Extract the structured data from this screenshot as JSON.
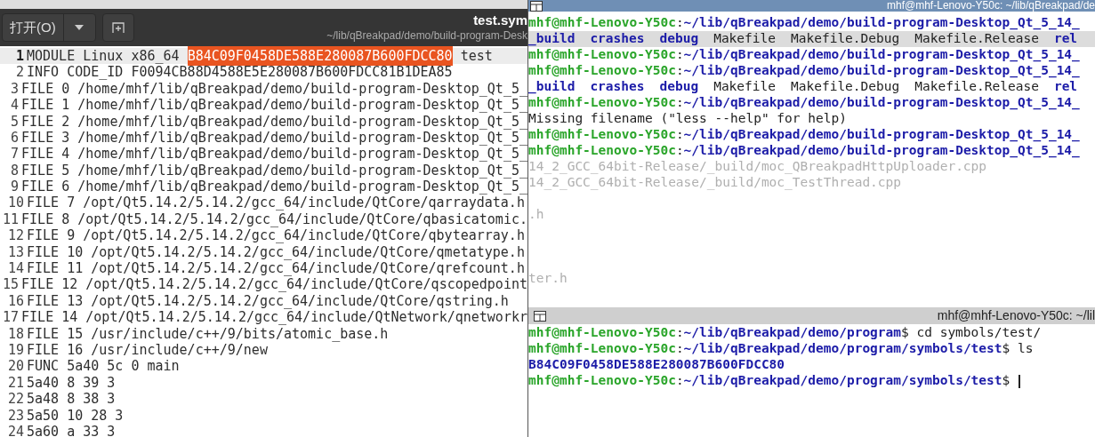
{
  "editor": {
    "open_button": "打开(O)",
    "title": "test.sym",
    "subtitle": "~/lib/qBreakpad/demo/build-program-Desk",
    "lines": [
      {
        "number": "1",
        "current": true,
        "segments": [
          {
            "text": "MODULE Linux x86_64 ",
            "selected": false
          },
          {
            "text": "B84C09F0458DE588E280087B600FDCC80",
            "selected": true
          },
          {
            "text": " test",
            "selected": false
          }
        ]
      },
      {
        "number": "2",
        "current": false,
        "text": "INFO CODE_ID F0094CB88D4588E5E280087B600FDCC81B1DEA85"
      },
      {
        "number": "3",
        "current": false,
        "text": "FILE 0 /home/mhf/lib/qBreakpad/demo/build-program-Desktop_Qt_5_"
      },
      {
        "number": "4",
        "current": false,
        "text": "FILE 1 /home/mhf/lib/qBreakpad/demo/build-program-Desktop_Qt_5_"
      },
      {
        "number": "5",
        "current": false,
        "text": "FILE 2 /home/mhf/lib/qBreakpad/demo/build-program-Desktop_Qt_5_"
      },
      {
        "number": "6",
        "current": false,
        "text": "FILE 3 /home/mhf/lib/qBreakpad/demo/build-program-Desktop_Qt_5_"
      },
      {
        "number": "7",
        "current": false,
        "text": "FILE 4 /home/mhf/lib/qBreakpad/demo/build-program-Desktop_Qt_5_"
      },
      {
        "number": "8",
        "current": false,
        "text": "FILE 5 /home/mhf/lib/qBreakpad/demo/build-program-Desktop_Qt_5_"
      },
      {
        "number": "9",
        "current": false,
        "text": "FILE 6 /home/mhf/lib/qBreakpad/demo/build-program-Desktop_Qt_5_"
      },
      {
        "number": "10",
        "current": false,
        "text": "FILE 7 /opt/Qt5.14.2/5.14.2/gcc_64/include/QtCore/qarraydata.h"
      },
      {
        "number": "11",
        "current": false,
        "text": "FILE 8 /opt/Qt5.14.2/5.14.2/gcc_64/include/QtCore/qbasicatomic."
      },
      {
        "number": "12",
        "current": false,
        "text": "FILE 9 /opt/Qt5.14.2/5.14.2/gcc_64/include/QtCore/qbytearray.h"
      },
      {
        "number": "13",
        "current": false,
        "text": "FILE 10 /opt/Qt5.14.2/5.14.2/gcc_64/include/QtCore/qmetatype.h"
      },
      {
        "number": "14",
        "current": false,
        "text": "FILE 11 /opt/Qt5.14.2/5.14.2/gcc_64/include/QtCore/qrefcount.h"
      },
      {
        "number": "15",
        "current": false,
        "text": "FILE 12 /opt/Qt5.14.2/5.14.2/gcc_64/include/QtCore/qscopedpoint"
      },
      {
        "number": "16",
        "current": false,
        "text": "FILE 13 /opt/Qt5.14.2/5.14.2/gcc_64/include/QtCore/qstring.h"
      },
      {
        "number": "17",
        "current": false,
        "text": "FILE 14 /opt/Qt5.14.2/5.14.2/gcc_64/include/QtNetwork/qnetworkr"
      },
      {
        "number": "18",
        "current": false,
        "text": "FILE 15 /usr/include/c++/9/bits/atomic_base.h"
      },
      {
        "number": "19",
        "current": false,
        "text": "FILE 16 /usr/include/c++/9/new"
      },
      {
        "number": "20",
        "current": false,
        "text": "FUNC 5a40 5c 0 main"
      },
      {
        "number": "21",
        "current": false,
        "text": "5a40 8 39 3"
      },
      {
        "number": "22",
        "current": false,
        "text": "5a48 8 38 3"
      },
      {
        "number": "23",
        "current": false,
        "text": "5a50 10 28 3"
      },
      {
        "number": "24",
        "current": false,
        "text": "5a60 a 33 3"
      }
    ]
  },
  "terminals": [
    {
      "title": "mhf@mhf-Lenovo-Y50c: ~/lib/qBreakpad/de",
      "lines": [
        {
          "kind": "prompt",
          "user": "mhf@mhf-Lenovo-Y50c",
          "colon": ":",
          "path": "~/lib/qBreakpad/demo/build-program-Desktop_Qt_5_14_"
        },
        {
          "kind": "listing",
          "highlighted": true,
          "items": [
            {
              "text": "_build",
              "kind": "dir"
            },
            {
              "text": "crashes",
              "kind": "dir"
            },
            {
              "text": "debug",
              "kind": "dir"
            },
            {
              "text": "Makefile",
              "kind": "file"
            },
            {
              "text": "Makefile.Debug",
              "kind": "file"
            },
            {
              "text": "Makefile.Release",
              "kind": "file"
            },
            {
              "text": "rel",
              "kind": "dir"
            }
          ]
        },
        {
          "kind": "prompt",
          "user": "mhf@mhf-Lenovo-Y50c",
          "colon": ":",
          "path": "~/lib/qBreakpad/demo/build-program-Desktop_Qt_5_14_"
        },
        {
          "kind": "prompt",
          "user": "mhf@mhf-Lenovo-Y50c",
          "colon": ":",
          "path": "~/lib/qBreakpad/demo/build-program-Desktop_Qt_5_14_"
        },
        {
          "kind": "listing",
          "highlighted": false,
          "items": [
            {
              "text": "_build",
              "kind": "dir"
            },
            {
              "text": "crashes",
              "kind": "dir"
            },
            {
              "text": "debug",
              "kind": "dir"
            },
            {
              "text": "Makefile",
              "kind": "file"
            },
            {
              "text": "Makefile.Debug",
              "kind": "file"
            },
            {
              "text": "Makefile.Release",
              "kind": "file"
            },
            {
              "text": "rel",
              "kind": "dir"
            }
          ]
        },
        {
          "kind": "prompt",
          "user": "mhf@mhf-Lenovo-Y50c",
          "colon": ":",
          "path": "~/lib/qBreakpad/demo/build-program-Desktop_Qt_5_14_"
        },
        {
          "kind": "output",
          "text": "Missing filename (\"less --help\" for help)"
        },
        {
          "kind": "prompt",
          "user": "mhf@mhf-Lenovo-Y50c",
          "colon": ":",
          "path": "~/lib/qBreakpad/demo/build-program-Desktop_Qt_5_14_"
        },
        {
          "kind": "prompt",
          "user": "mhf@mhf-Lenovo-Y50c",
          "colon": ":",
          "path": "~/lib/qBreakpad/demo/build-program-Desktop_Qt_5_14_"
        },
        {
          "kind": "ghost",
          "text": "14_2_GCC_64bit-Release/_build/moc_QBreakpadHttpUploader.cpp"
        },
        {
          "kind": "ghost",
          "text": "14_2_GCC_64bit-Release/_build/moc_TestThread.cpp"
        },
        {
          "kind": "blank"
        },
        {
          "kind": "ghost",
          "text": ".h"
        },
        {
          "kind": "blank"
        },
        {
          "kind": "blank"
        },
        {
          "kind": "blank"
        },
        {
          "kind": "ghost",
          "text": "ter.h"
        }
      ]
    },
    {
      "title": "mhf@mhf-Lenovo-Y50c: ~/lil",
      "lines": [
        {
          "kind": "prompt",
          "user": "mhf@mhf-Lenovo-Y50c",
          "colon": ":",
          "path": "~/lib/qBreakpad/demo/program",
          "symbol": "$",
          "command": "cd symbols/test/"
        },
        {
          "kind": "prompt",
          "user": "mhf@mhf-Lenovo-Y50c",
          "colon": ":",
          "path": "~/lib/qBreakpad/demo/program/symbols/test",
          "symbol": "$",
          "command": "ls"
        },
        {
          "kind": "listing",
          "highlighted": false,
          "items": [
            {
              "text": "B84C09F0458DE588E280087B600FDCC80",
              "kind": "dir"
            }
          ]
        },
        {
          "kind": "prompt",
          "user": "mhf@mhf-Lenovo-Y50c",
          "colon": ":",
          "path": "~/lib/qBreakpad/demo/program/symbols/test",
          "symbol": "$",
          "cursor": true
        }
      ]
    }
  ]
}
